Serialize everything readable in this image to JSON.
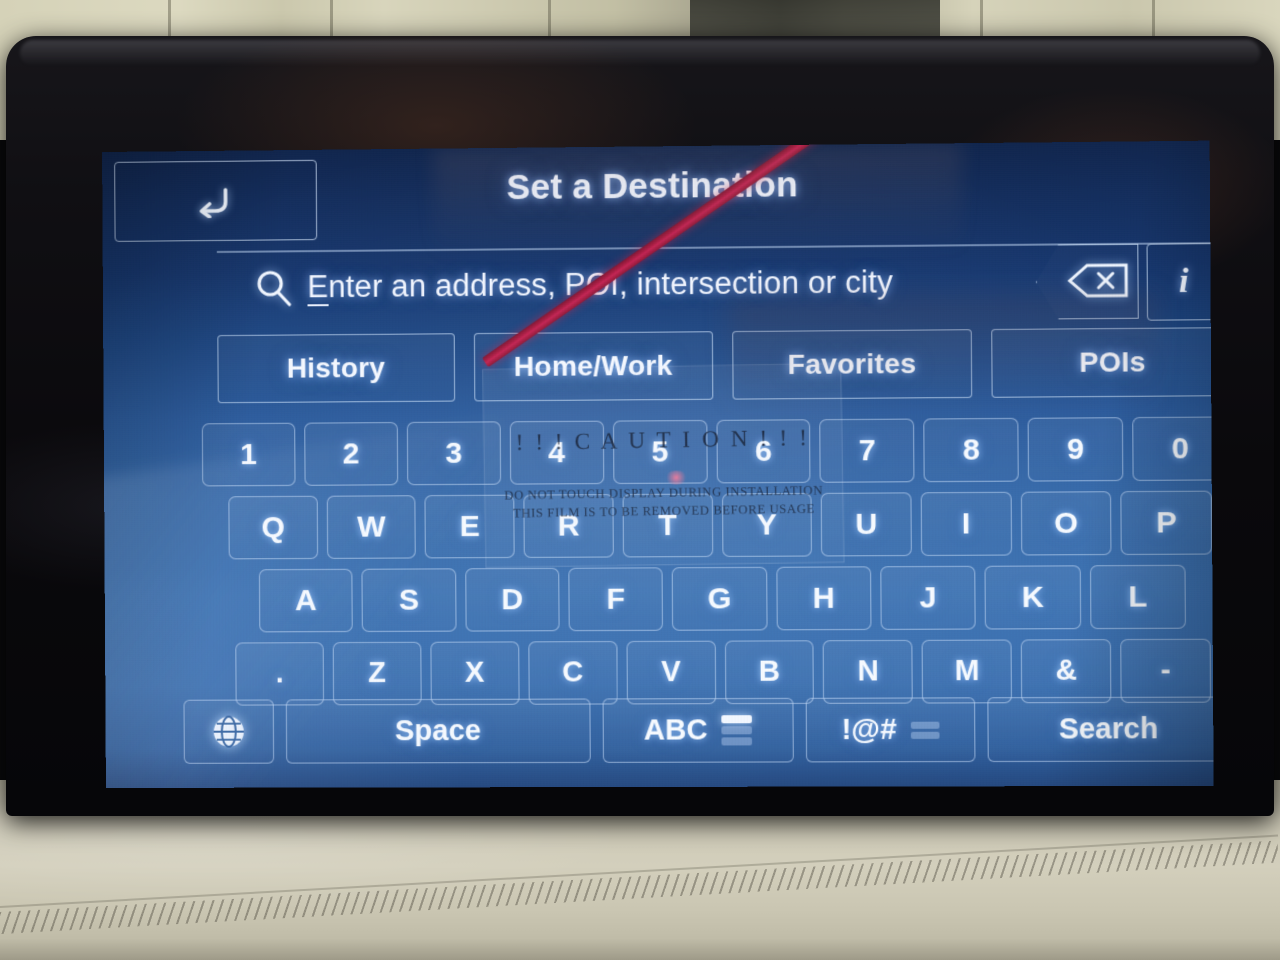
{
  "screen": {
    "title": "Set a Destination",
    "back_icon": "back-arrow-icon",
    "info_label": "i"
  },
  "search": {
    "icon": "search-icon",
    "placeholder": "Enter an address, POI, intersection or city",
    "placeholder_first_letter": "E",
    "placeholder_rest": "nter an address, POI, intersection or city",
    "backspace_icon": "backspace-icon",
    "value": ""
  },
  "tabs": [
    {
      "label": "History"
    },
    {
      "label": "Home/Work"
    },
    {
      "label": "Favorites"
    },
    {
      "label": "POIs"
    }
  ],
  "keyboard": {
    "rows": [
      [
        "1",
        "2",
        "3",
        "4",
        "5",
        "6",
        "7",
        "8",
        "9",
        "0"
      ],
      [
        "Q",
        "W",
        "E",
        "R",
        "T",
        "Y",
        "U",
        "I",
        "O",
        "P"
      ],
      [
        "A",
        "S",
        "D",
        "F",
        "G",
        "H",
        "J",
        "K",
        "L"
      ],
      [
        ".",
        "Z",
        "X",
        "C",
        "V",
        "B",
        "N",
        "M",
        "&",
        "-"
      ]
    ],
    "function_row": {
      "globe_icon": "globe-language-icon",
      "space_label": "Space",
      "abc_label": "ABC",
      "symbols_label": "!@#",
      "search_label": "Search"
    }
  },
  "overlay_film": {
    "caution": "! ! !  C A U T I O N  ! ! !",
    "line1": "DO NOT TOUCH DISPLAY DURING INSTALLATION",
    "line2": "THIS FILM IS TO BE REMOVED BEFORE USAGE"
  },
  "colors": {
    "panel_top": "#10254d",
    "panel_bottom": "#3b71b2",
    "key_text": "#f6faff",
    "key_border": "#c6dcf8",
    "stripe_red": "#a81840",
    "bezel": "#0a090c",
    "dash_beige": "#d3cfbc"
  }
}
